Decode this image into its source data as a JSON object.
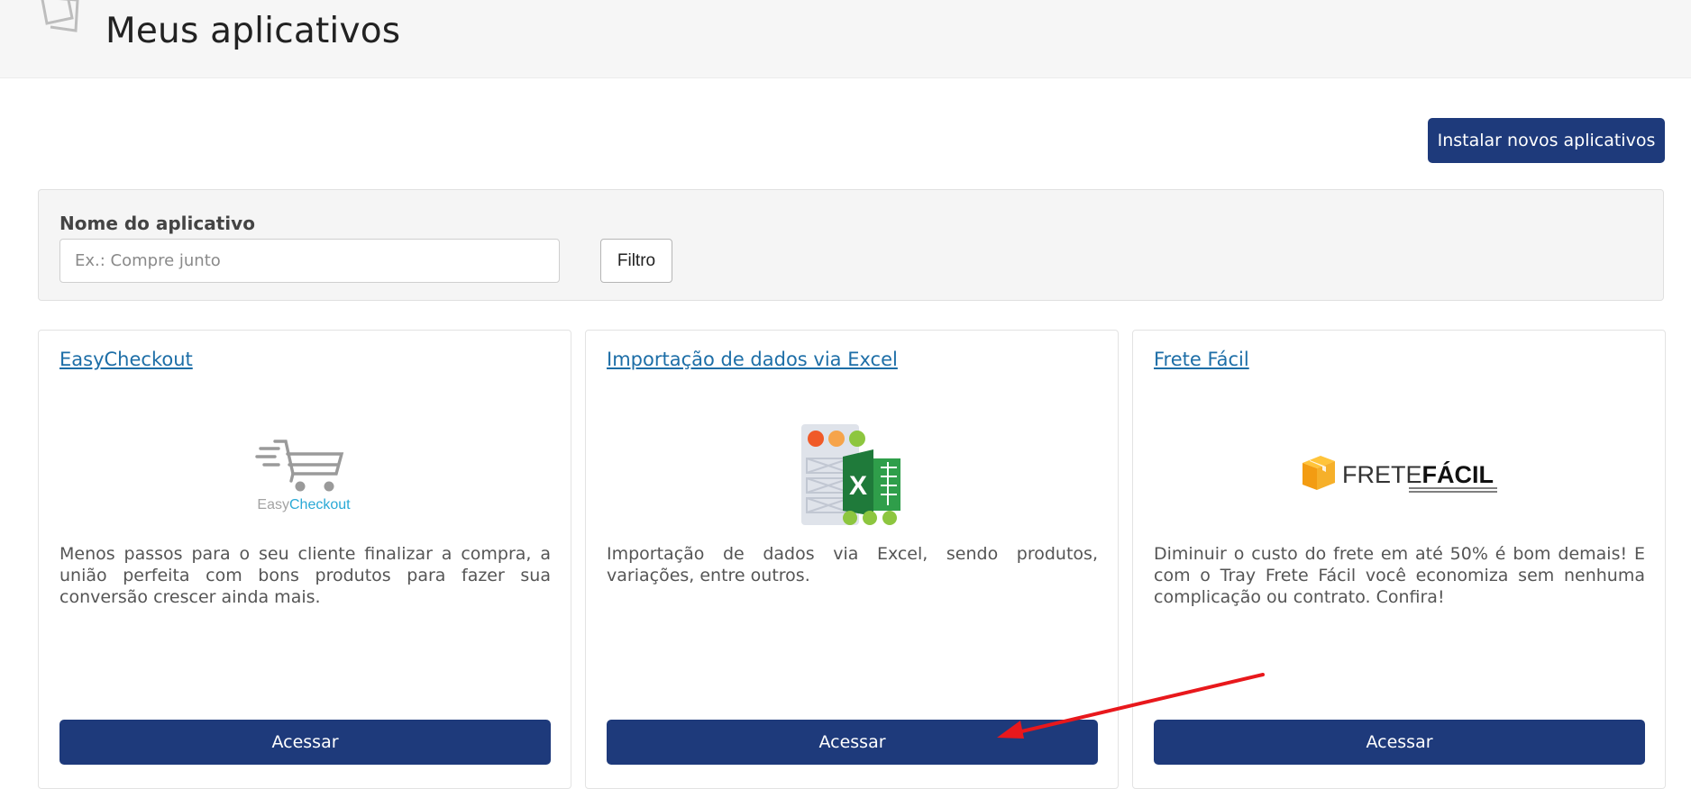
{
  "header": {
    "title": "Meus aplicativos",
    "icon": "apps-icon"
  },
  "toolbar": {
    "install_label": "Instalar novos aplicativos"
  },
  "filter": {
    "label": "Nome do aplicativo",
    "placeholder": "Ex.: Compre junto",
    "value": "",
    "button_label": "Filtro"
  },
  "apps": [
    {
      "title": "EasyCheckout",
      "logo": {
        "icon": "shopping-cart-icon",
        "text_part1": "Easy",
        "text_part2": "Checkout"
      },
      "description": "Menos passos para o seu cliente finalizar a compra, a união perfeita com bons produtos para fazer sua conversão crescer ainda mais.",
      "button_label": "Acessar"
    },
    {
      "title": "Importação de dados via Excel",
      "logo": {
        "icon": "excel-import-icon",
        "letter": "X"
      },
      "description": "Importação de dados via Excel, sendo produtos, variações, entre outros.",
      "button_label": "Acessar"
    },
    {
      "title": "Frete Fácil",
      "logo": {
        "icon": "package-box-icon",
        "text_part1": "FRETE",
        "text_part2": "FÁCIL"
      },
      "description": "Diminuir o custo do frete em até 50% é bom demais! E com o Tray Frete Fácil você economiza sem nenhuma complicação ou contrato. Confira!",
      "button_label": "Acessar"
    }
  ],
  "annotation": {
    "color": "#e8181c",
    "icon": "red-arrow-annotation"
  },
  "colors": {
    "primary": "#1e3a7b",
    "link": "#1d6ea7",
    "panel": "#f5f5f5"
  }
}
